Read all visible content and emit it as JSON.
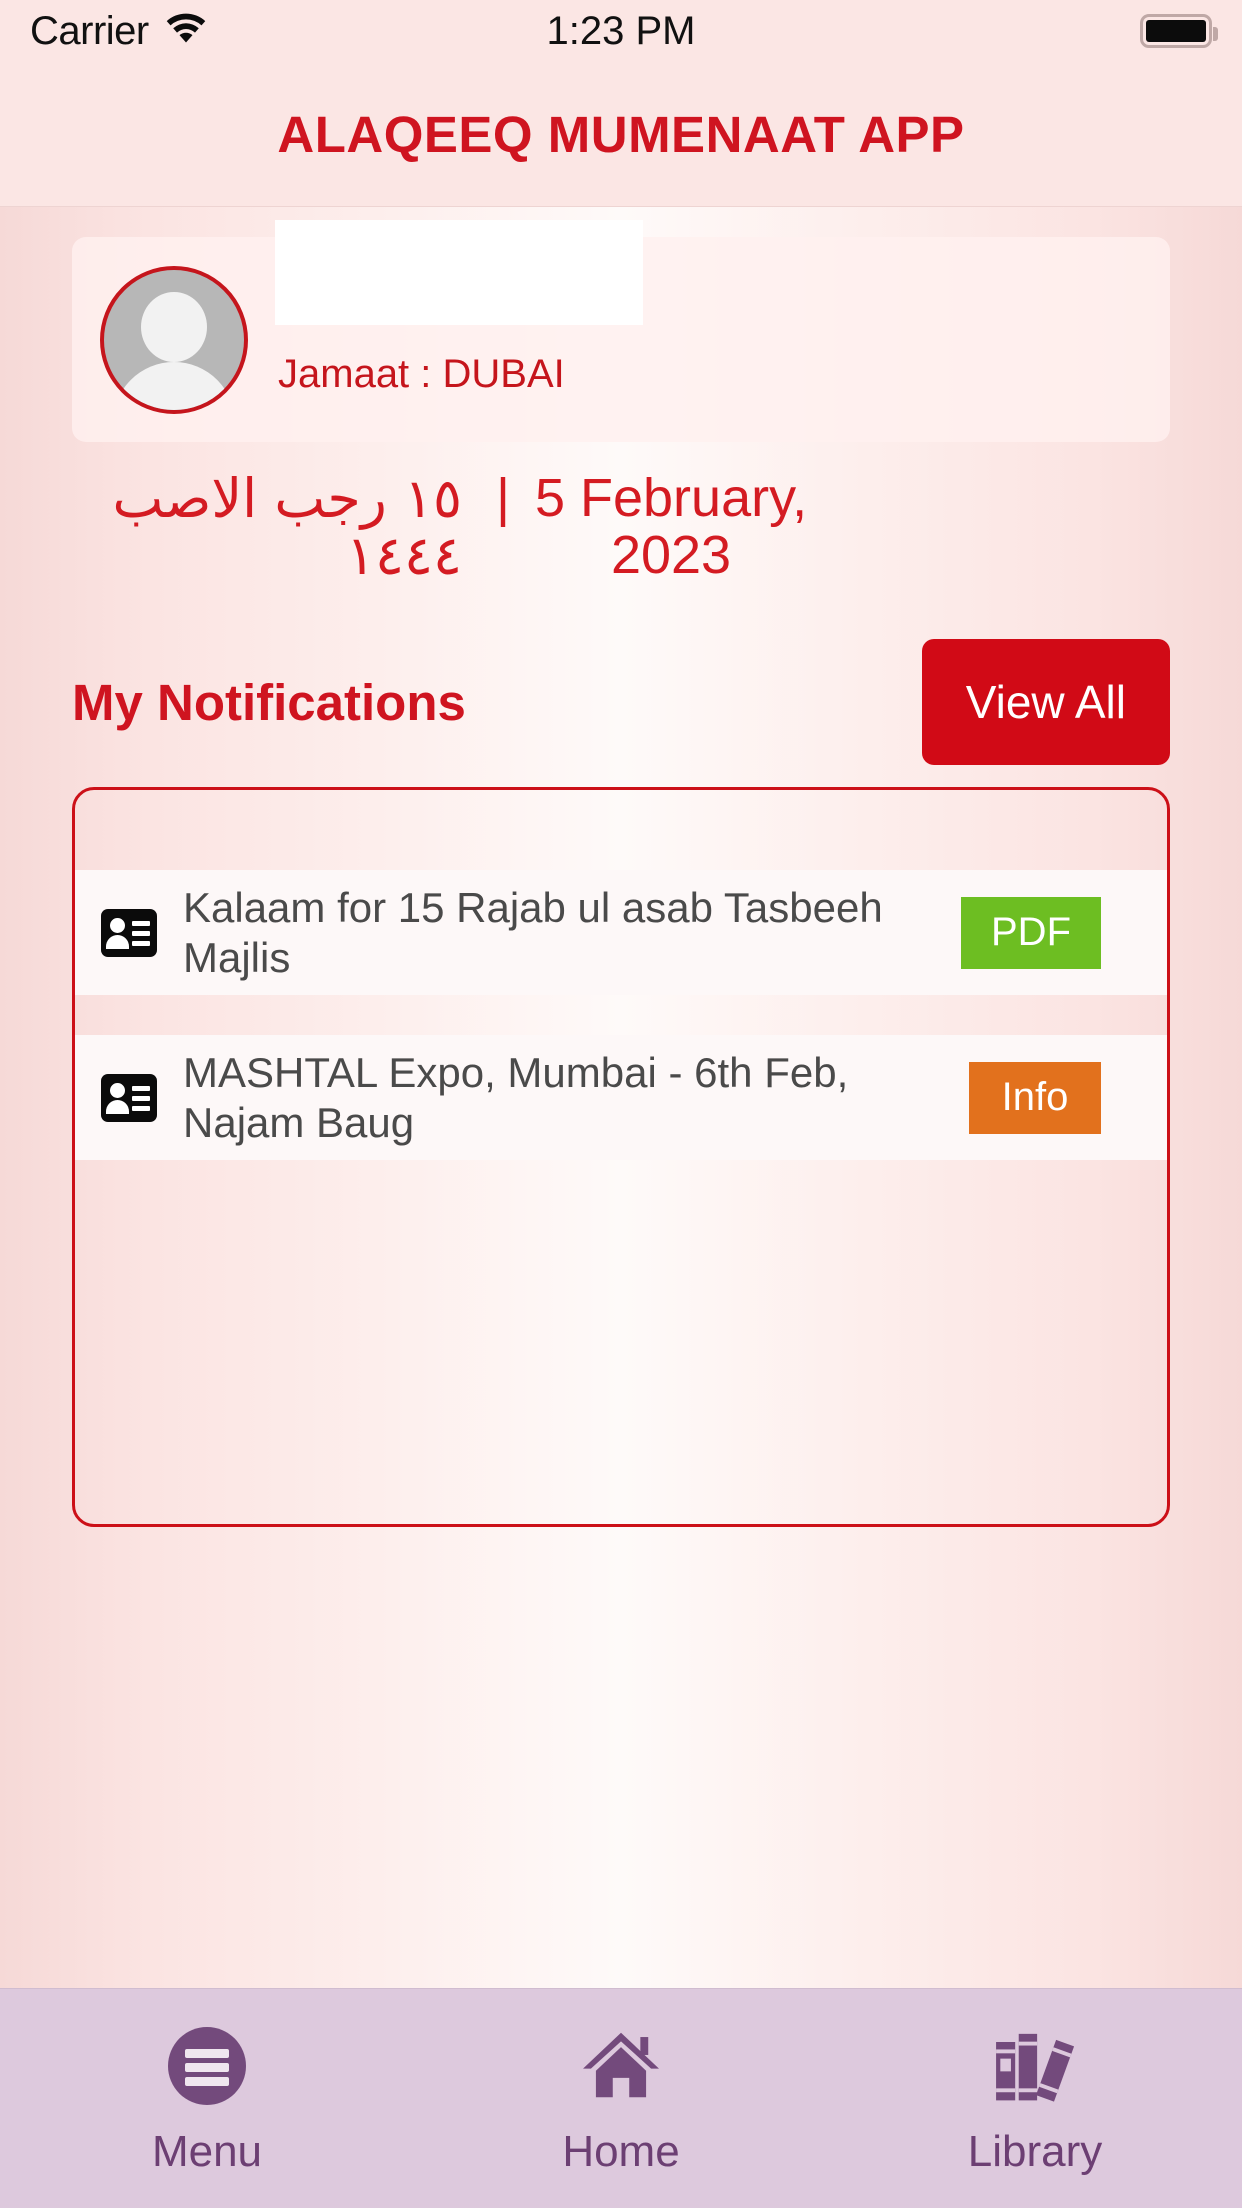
{
  "status_bar": {
    "carrier": "Carrier",
    "time": "1:23 PM",
    "wifi_icon": "wifi-icon",
    "battery_icon": "battery-full-icon"
  },
  "header": {
    "title": "ALAQEEQ MUMENAAT APP",
    "title_color": "#cf1420"
  },
  "profile": {
    "avatar_icon": "person-avatar-icon",
    "name_redacted": "",
    "jamaat": "Jamaat : DUBAI"
  },
  "date": {
    "hijri": "١٥ رجب الاصب ١٤٤٤",
    "separator": "|",
    "gregorian": "5 February, 2023",
    "color": "#d41b22"
  },
  "notifications": {
    "section_title": "My Notifications",
    "view_all_label": "View All",
    "view_all_color": "#d10a16",
    "items": [
      {
        "icon": "contact-card-icon",
        "text": "Kalaam for 15 Rajab ul asab Tasbeeh Majlis",
        "badge_label": "PDF",
        "badge_color": "#6dbe22"
      },
      {
        "icon": "contact-card-icon",
        "text": "MASHTAL Expo, Mumbai - 6th Feb, Najam Baug",
        "badge_label": "Info",
        "badge_color": "#e2711d"
      }
    ]
  },
  "tabbar": {
    "accent_color": "#6c3f73",
    "background_color": "#ddc9dd",
    "items": [
      {
        "label": "Menu",
        "icon": "hamburger-menu-icon",
        "active": false
      },
      {
        "label": "Home",
        "icon": "home-icon",
        "active": true
      },
      {
        "label": "Library",
        "icon": "books-library-icon",
        "active": false
      }
    ]
  }
}
